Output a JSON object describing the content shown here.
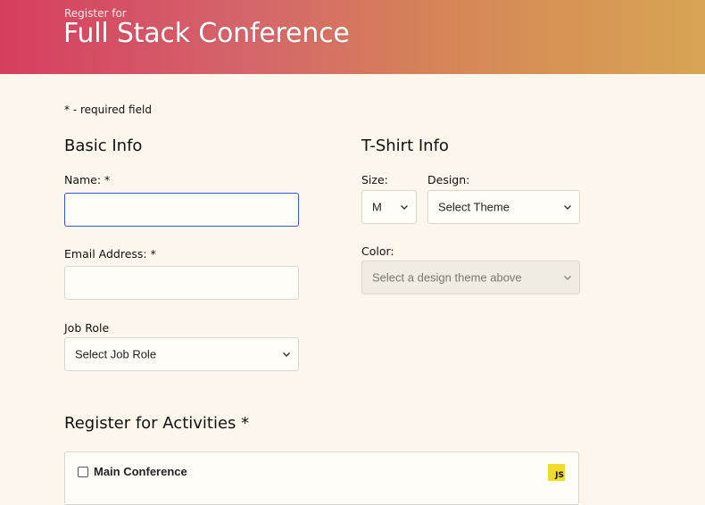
{
  "header": {
    "pre_title": "Register for",
    "title": "Full Stack Conference",
    "gradient_colors": [
      "#d63e5f",
      "#d4656a",
      "#d68756",
      "#d8a454"
    ]
  },
  "required_note": "* - required field",
  "basic_info": {
    "heading": "Basic Info",
    "name_label": "Name: *",
    "name_value": "",
    "email_label": "Email Address: *",
    "email_value": "",
    "job_role_label": "Job Role",
    "job_role_selected": "Select Job Role"
  },
  "tshirt_info": {
    "heading": "T-Shirt Info",
    "size_label": "Size:",
    "size_selected": "M",
    "design_label": "Design:",
    "design_selected": "Select Theme",
    "color_label": "Color:",
    "color_selected": "Select a design theme above"
  },
  "activities": {
    "heading": "Register for Activities *",
    "items": [
      {
        "name": "Main Conference",
        "checked": false,
        "badge": "JS"
      }
    ]
  },
  "icons": {
    "select_arrow": "chevron-down-icon",
    "activity_badge": "javascript-logo-icon"
  },
  "colors": {
    "page_background": "#fcf6ec",
    "focus_border": "#3458d0",
    "js_badge": "#f0db2b"
  }
}
